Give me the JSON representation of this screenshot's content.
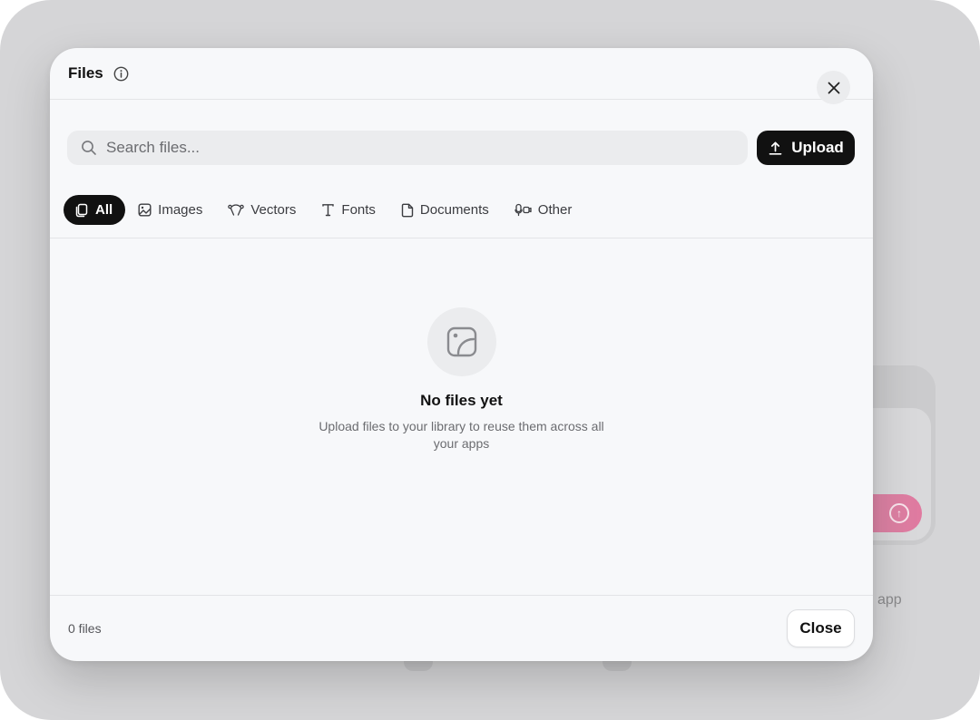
{
  "background": {
    "app_text": "app"
  },
  "modal": {
    "title": "Files",
    "search": {
      "placeholder": "Search files..."
    },
    "upload_label": "Upload",
    "tabs": [
      {
        "label": "All",
        "icon": "copy-icon",
        "active": true
      },
      {
        "label": "Images",
        "icon": "image-icon",
        "active": false
      },
      {
        "label": "Vectors",
        "icon": "vector-icon",
        "active": false
      },
      {
        "label": "Fonts",
        "icon": "type-icon",
        "active": false
      },
      {
        "label": "Documents",
        "icon": "document-icon",
        "active": false
      },
      {
        "label": "Other",
        "icon": "other-icon",
        "active": false
      }
    ],
    "empty": {
      "title": "No files yet",
      "description": "Upload files to your library to reuse them across all your apps"
    },
    "footer": {
      "file_count": "0 files",
      "close_label": "Close"
    }
  },
  "colors": {
    "accent": "#111111",
    "modal_bg": "#f7f8fa",
    "backdrop": "#d5d5d7"
  }
}
